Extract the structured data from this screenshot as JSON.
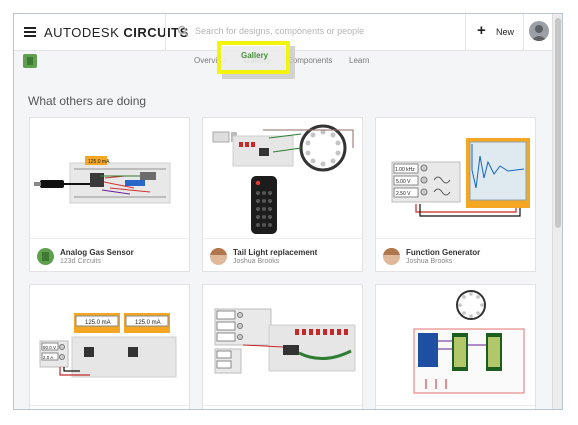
{
  "header": {
    "brand_prefix": "AUTODESK",
    "brand_suffix": "CIRCUITS",
    "search_placeholder": "Search for designs, components or people",
    "new_label": "New"
  },
  "subnav": {
    "tabs": [
      {
        "label": "Overview",
        "state": "normal"
      },
      {
        "label": "Gallery",
        "state": "active"
      },
      {
        "label": "Components",
        "state": "normal"
      },
      {
        "label": "Learn",
        "state": "normal"
      }
    ]
  },
  "main": {
    "section_title": "What others are doing",
    "cards": [
      {
        "title": "Analog Gas Sensor",
        "author": "123d Circuits",
        "avatar": "green-logo-icon"
      },
      {
        "title": "Tail Light replacement",
        "author": "Joshua Brooks",
        "avatar": "user-photo"
      },
      {
        "title": "Function Generator",
        "author": "Joshua Brooks",
        "avatar": "user-photo"
      },
      {
        "title": "",
        "author": "",
        "avatar": ""
      },
      {
        "title": "",
        "author": "",
        "avatar": ""
      },
      {
        "title": "",
        "author": "",
        "avatar": ""
      }
    ],
    "thumb_texts": {
      "gas_meter": "125.0 mA",
      "fg_freq": "1.00 kHz",
      "fg_v1": "5.00 V",
      "fg_v2": "2.50 V",
      "meter_a": "125.0 mA",
      "meter_b": "125.0 mA",
      "ps_v": "50.0 V",
      "ps_a": "2.0 A"
    }
  },
  "colors": {
    "accent_green": "#4a8f3f",
    "highlight_yellow": "#f2f40b",
    "meter_orange": "#f5a623"
  }
}
